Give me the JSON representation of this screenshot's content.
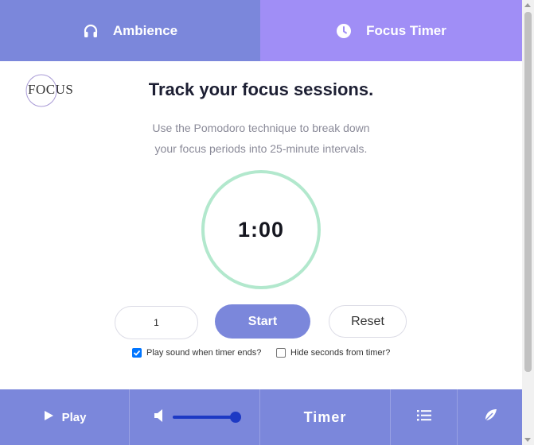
{
  "tabs": [
    {
      "label": "Ambience",
      "icon": "headphones-icon"
    },
    {
      "label": "Focus Timer",
      "icon": "clock-icon"
    }
  ],
  "logo": {
    "text": "FOCUS"
  },
  "main": {
    "heading": "Track your focus sessions.",
    "description_line1": "Use the Pomodoro technique to break down",
    "description_line2": "your focus periods into 25-minute intervals.",
    "timer_display": "1:00"
  },
  "controls": {
    "minutes_value": "1",
    "start_label": "Start",
    "reset_label": "Reset"
  },
  "options": {
    "play_sound_label": "Play sound when timer ends?",
    "play_sound_checked": true,
    "hide_seconds_label": "Hide seconds from timer?",
    "hide_seconds_checked": false
  },
  "bottom": {
    "play_label": "Play",
    "timer_label": "Timer",
    "volume_level": 1.0
  },
  "colors": {
    "ambience_tab": "#7b87db",
    "timer_tab": "#a08ef6",
    "ring": "#b2e8cd",
    "accent": "#7b87db",
    "slider": "#1d39c4"
  }
}
